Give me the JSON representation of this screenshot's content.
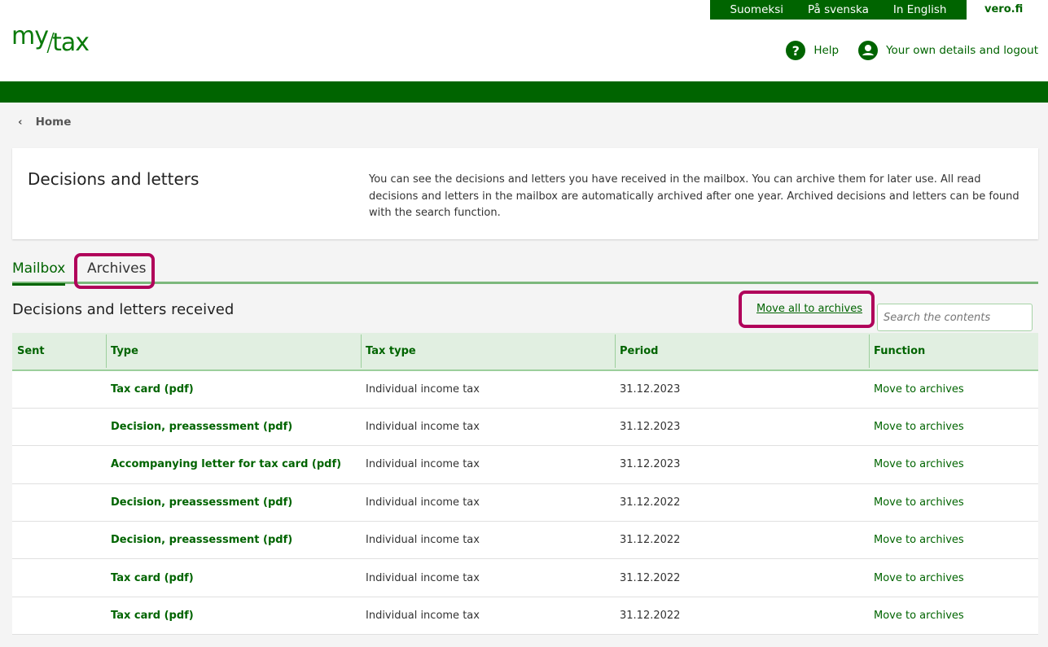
{
  "languages": [
    "Suomeksi",
    "På svenska",
    "In English"
  ],
  "vero": "vero.fi",
  "logo": {
    "my": "my",
    "slash": "/",
    "tax": "tax"
  },
  "help": "Help",
  "account": "Your own details and logout",
  "breadcrumb": "Home",
  "page": {
    "title": "Decisions and letters",
    "description": "You can see the decisions and letters you have received in the mailbox. You can archive them for later use. All read decisions and letters in the mailbox are automatically archived after one year. Archived decisions and letters can be found with the search function."
  },
  "tabs": [
    "Mailbox",
    "Archives"
  ],
  "section_title": "Decisions and letters received",
  "move_all": "Move all to archives",
  "search_placeholder": "Search the contents",
  "columns": [
    "Sent",
    "Type",
    "Tax type",
    "Period",
    "Function"
  ],
  "rows": [
    {
      "sent": "",
      "type": "Tax card (pdf)",
      "tax_type": "Individual income tax",
      "period": "31.12.2023",
      "fn": "Move to archives"
    },
    {
      "sent": "",
      "type": "Decision, preassessment (pdf)",
      "tax_type": "Individual income tax",
      "period": "31.12.2023",
      "fn": "Move to archives"
    },
    {
      "sent": "",
      "type": "Accompanying letter for tax card (pdf)",
      "tax_type": "Individual income tax",
      "period": "31.12.2023",
      "fn": "Move to archives"
    },
    {
      "sent": "",
      "type": "Decision, preassessment (pdf)",
      "tax_type": "Individual income tax",
      "period": "31.12.2022",
      "fn": "Move to archives"
    },
    {
      "sent": "",
      "type": "Decision, preassessment (pdf)",
      "tax_type": "Individual income tax",
      "period": "31.12.2022",
      "fn": "Move to archives"
    },
    {
      "sent": "",
      "type": "Tax card (pdf)",
      "tax_type": "Individual income tax",
      "period": "31.12.2022",
      "fn": "Move to archives"
    },
    {
      "sent": "",
      "type": "Tax card (pdf)",
      "tax_type": "Individual income tax",
      "period": "31.12.2022",
      "fn": "Move to archives"
    }
  ]
}
